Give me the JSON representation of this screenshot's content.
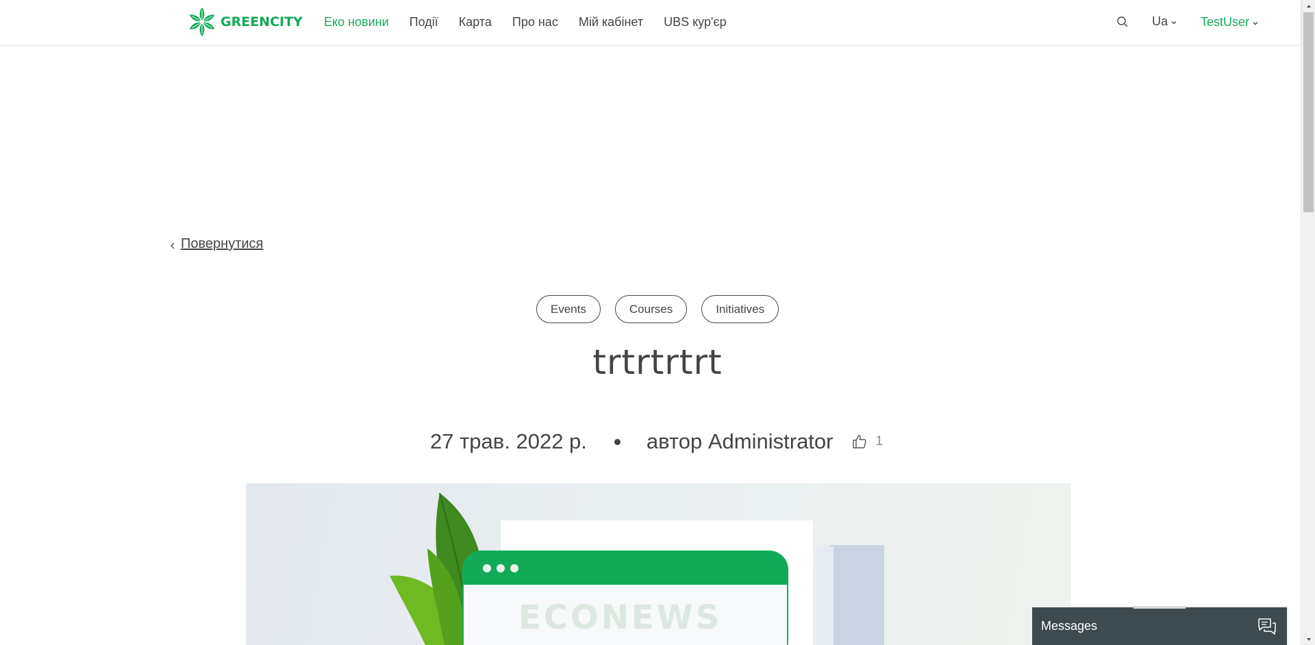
{
  "header": {
    "logo_text": "GREENCITY",
    "nav": [
      {
        "label": "Еко новини",
        "active": true
      },
      {
        "label": "Події",
        "active": false
      },
      {
        "label": "Карта",
        "active": false
      },
      {
        "label": "Про нас",
        "active": false
      },
      {
        "label": "Мій кабінет",
        "active": false
      },
      {
        "label": "UBS кур'єр",
        "active": false
      }
    ],
    "language": "Ua",
    "user": "TestUser"
  },
  "article": {
    "back_label": "Повернутися",
    "tags": [
      "Events",
      "Courses",
      "Initiatives"
    ],
    "title": "trtrtrtrt",
    "date": "27 трав. 2022 р.",
    "author": "автор Administrator",
    "likes": "1",
    "image_text": "ECONEWS"
  },
  "messages": {
    "label": "Messages"
  },
  "colors": {
    "accent": "#13AA57",
    "text": "#444444",
    "messages_bg": "#3d4a4f"
  }
}
